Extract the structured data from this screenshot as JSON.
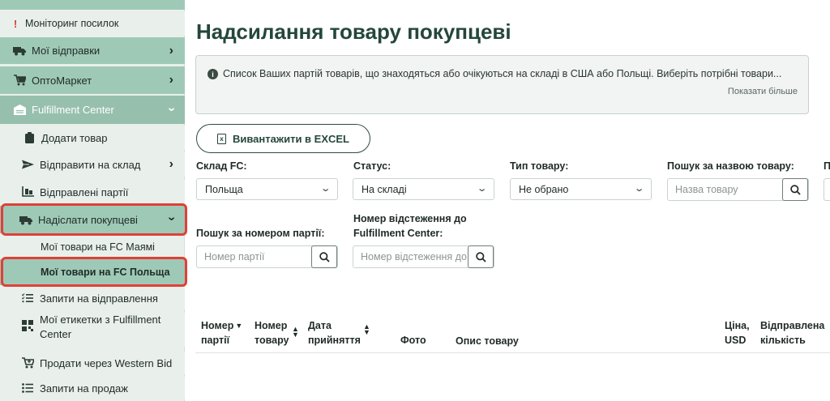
{
  "sidebar": {
    "monitoring": "Моніторинг посилок",
    "my_shipments": "Мої відправки",
    "optomarket": "ОптоМаркет",
    "fulfillment": "Fulfillment Center",
    "add_product": "Додати товар",
    "send_to_warehouse": "Відправити на склад",
    "sent_batches": "Відправлені партії",
    "send_to_buyer": "Надіслати покупцеві",
    "fc_miami": "Мої товари на FC Маямі",
    "fc_poland": "Мої товари на FC Польща",
    "requests_shipping": "Запити на відправлення",
    "labels": "Мої етикетки з Fulfillment Center",
    "sell_wb": "Продати через Western Bid",
    "sale_requests": "Запити на продаж"
  },
  "main": {
    "title": "Надсилання товару покупцеві",
    "info_text": "Список Ваших партій товарів, що знаходяться або очікуються на складі в США або Польщі. Виберіть потрібні товари...",
    "show_more": "Показати більше",
    "excel_button": "Вивантажити в EXCEL"
  },
  "filters": {
    "warehouse_label": "Склад FC:",
    "warehouse_value": "Польща",
    "status_label": "Статус:",
    "status_value": "На складі",
    "type_label": "Тип товару:",
    "type_value": "Не обрано",
    "search_name_label": "Пошук за назвою товару:",
    "search_name_placeholder": "Назва товару",
    "extra_label": "П",
    "batch_label": "Пошук за номером партії:",
    "batch_placeholder": "Номер партії",
    "tracking_label_1": "Номер відстеження до",
    "tracking_label_2": "Fulfillment Center:",
    "tracking_placeholder": "Номер відстеження до"
  },
  "table": {
    "col_batch_1": "Номер",
    "col_batch_2": "партії",
    "col_item_1": "Номер",
    "col_item_2": "товару",
    "col_date_1": "Дата",
    "col_date_2": "прийняття",
    "col_photo": "Фото",
    "col_desc": "Опис товару",
    "col_price_1": "Ціна,",
    "col_price_2": "USD",
    "col_qty_1": "Відправлена",
    "col_qty_2": "кількість"
  },
  "colors": {
    "accent_green": "#9fc9b7",
    "title_green": "#24473b",
    "highlight_red": "#e04036"
  }
}
